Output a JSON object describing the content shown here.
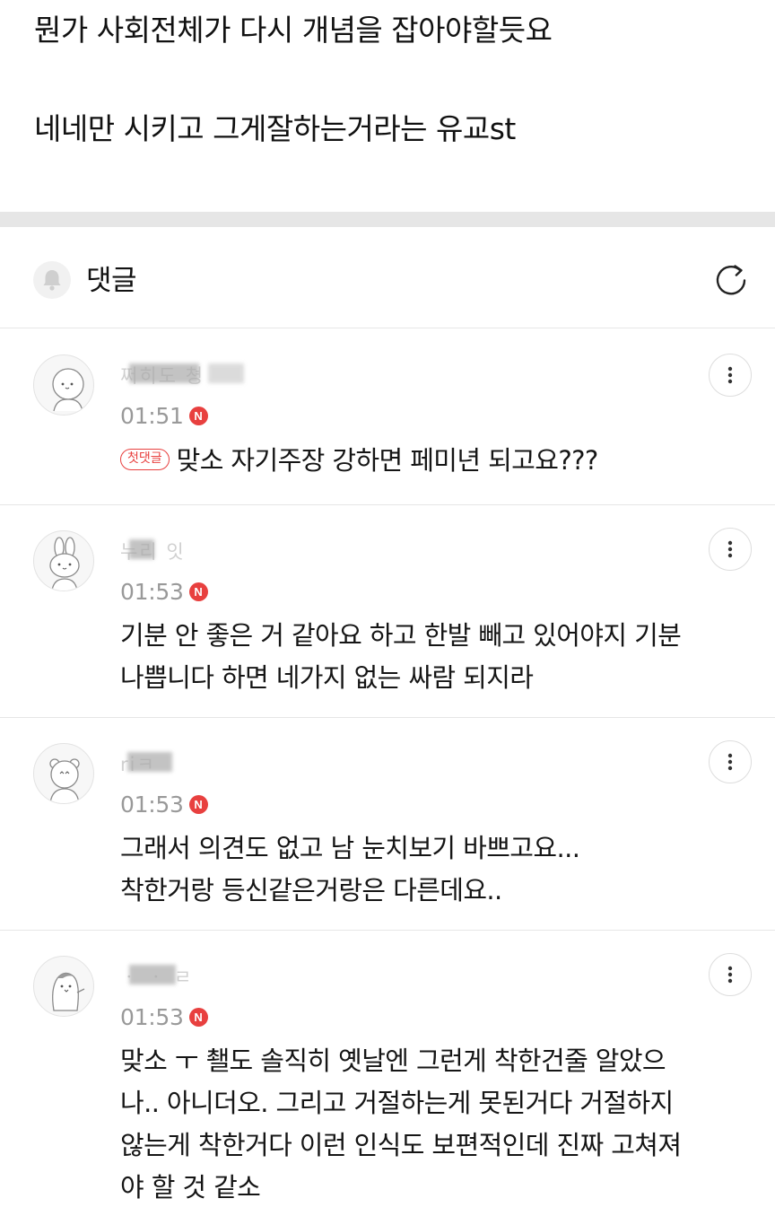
{
  "post": {
    "lines": [
      "뭔가 사회전체가 다시 개념을 잡아야할듯요",
      "네네만 시키고 그게잘하는거라는 유교st"
    ]
  },
  "comments_section": {
    "title": "댓글",
    "bell_icon": "bell-icon",
    "refresh_icon": "refresh-icon"
  },
  "comments": [
    {
      "nickname": "쩌히도 쳥",
      "time": "01:51",
      "new_badge": "N",
      "first_badge": "첫댓글",
      "lines": [
        "맞소 자기주장 강하면 페미년 되고요???"
      ]
    },
    {
      "nickname": "누리 잇",
      "time": "01:53",
      "new_badge": "N",
      "lines": [
        "기분 안 좋은 거 같아요 하고 한발 빼고 있어야지 기분",
        "나쁩니다 하면 네가지 없는 싸람 되지라"
      ]
    },
    {
      "nickname": "riㅋ",
      "time": "01:53",
      "new_badge": "N",
      "lines": [
        "그래서 의견도 없고 남 눈치보기 바쁘고요...",
        "착한거랑 등신같은거랑은 다른데요.."
      ]
    },
    {
      "nickname": "ㆍ ㆍ ㄹ",
      "time": "01:53",
      "new_badge": "N",
      "lines": [
        "맞소 ㅜ 쵈도 솔직히 옛날엔 그런게 착한건줄 알았으",
        "나.. 아니더오. 그리고 거절하는게 못된거다 거절하지",
        "않는게 착한거다 이런 인식도 보편적인데 진짜 고쳐져",
        "야 할 것 같소"
      ]
    }
  ]
}
